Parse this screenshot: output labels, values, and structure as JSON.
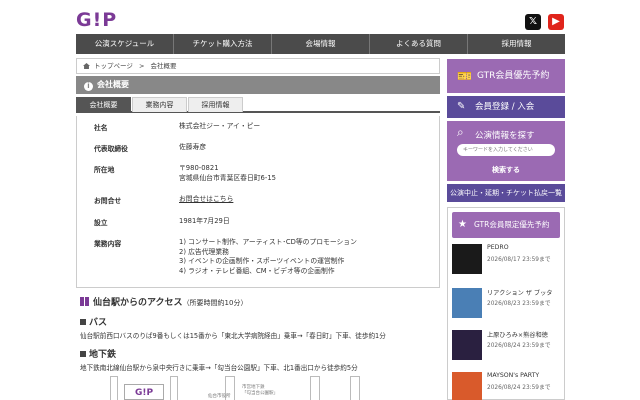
{
  "header": {
    "logo": "G!P",
    "social": [
      {
        "icon": "x-icon",
        "label": "𝕏",
        "color": "#111111"
      },
      {
        "icon": "youtube-icon",
        "label": "▶",
        "color": "#e0241b"
      }
    ]
  },
  "nav": [
    "公演スケジュール",
    "チケット購入方法",
    "会場情報",
    "よくある質問",
    "採用情報"
  ],
  "breadcrumb": {
    "home": "トップページ",
    "sep": ">",
    "current": "会社概要"
  },
  "section_title": "会社概要",
  "tabs": [
    "会社概要",
    "業務内容",
    "採用情報"
  ],
  "profile": [
    {
      "key": "社名",
      "value": "株式会社ジー・アイ・ピー"
    },
    {
      "key": "代表取締役",
      "value": "佐藤寿彦"
    },
    {
      "key": "所在地",
      "value": "〒980-0821\n宮城県仙台市青葉区春日町6-15"
    },
    {
      "key": "お問合せ",
      "value": "お問合せはこちら",
      "link": true
    },
    {
      "key": "設立",
      "value": "1981年7月29日"
    },
    {
      "key": "業務内容",
      "value": "1) コンサート制作、アーティスト･CD等のプロモーション\n2) 広告代理業務\n3) イベントの企画制作・スポーツイベントの運営制作\n4) ラジオ・テレビ番組、CM・ビデオ等の企画制作"
    }
  ],
  "access": {
    "title": "仙台駅からのアクセス",
    "subtitle": "（所要時間約10分）",
    "bus_title": "バス",
    "bus_text": "仙台駅前西口バスのりば9番もしくは15番から「東北大学病院経由」乗車→「春日町」下車、徒歩約1分",
    "subway_title": "地下鉄",
    "subway_text": "地下鉄南北線仙台駅から泉中央行きに乗車→「勾当台公園駅」下車、北1番出口から徒歩約5分",
    "map_logo": "G!P",
    "map_notes": [
      "市営地下鉄\n「勾当台公園駅」",
      "仙台市役所"
    ]
  },
  "sidebar": {
    "gtr_label": "GTR会員優先予約",
    "register_label": "会員登録 / 入会",
    "search_title": "公演情報を探す",
    "search_placeholder": "キーワードを入力してください",
    "search_button": "検索する",
    "notice_label": "公演中止・延期・チケット払戻一覧",
    "promo_title": "GTR会員限定優先予約",
    "promos": [
      {
        "title": "PEDRO",
        "date": "2026/08/17 23:59まで",
        "color": "#1a1a1a"
      },
      {
        "title": "リアクション ザ ブッタ",
        "date": "2026/08/23 23:59まで",
        "color": "#4a7fb5"
      },
      {
        "title": "上原ひろみ×熊谷和徳",
        "date": "2026/08/24 23:59まで",
        "color": "#2a2040"
      },
      {
        "title": "MAYSON's PARTY",
        "date": "2026/08/24 23:59まで",
        "color": "#d95a2b"
      }
    ]
  }
}
